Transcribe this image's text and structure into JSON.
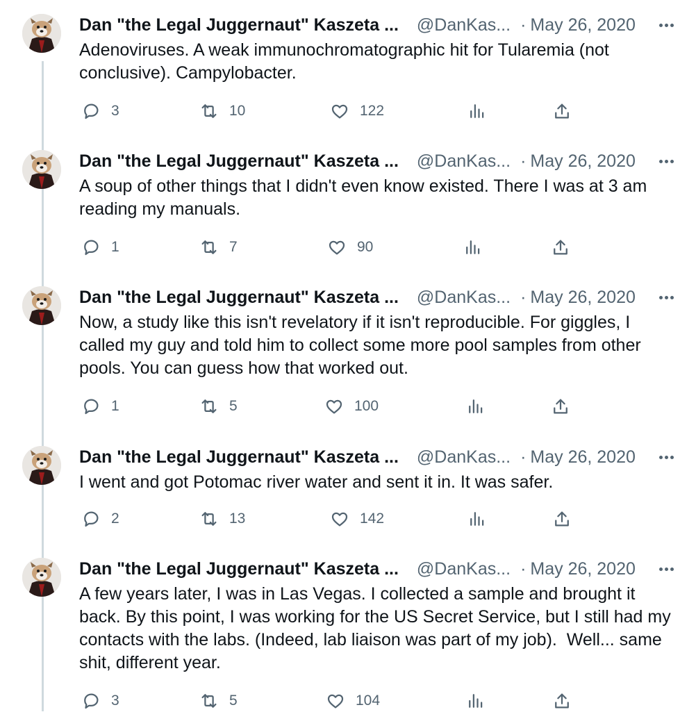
{
  "tweets": [
    {
      "name": "Dan \"the Legal Juggernaut\" Kaszeta ...",
      "handle": "@DanKas...",
      "dot": "·",
      "date": "May 26, 2020",
      "text": "Adenoviruses. A weak immunochromatographic hit for Tularemia (not conclusive). Campylobacter.",
      "replies": "3",
      "retweets": "10",
      "likes": "122"
    },
    {
      "name": "Dan \"the Legal Juggernaut\" Kaszeta ...",
      "handle": "@DanKas...",
      "dot": "·",
      "date": "May 26, 2020",
      "text": "A soup of other things that I didn't even know existed. There I was at 3 am reading my manuals.",
      "replies": "1",
      "retweets": "7",
      "likes": "90"
    },
    {
      "name": "Dan \"the Legal Juggernaut\" Kaszeta ...",
      "handle": "@DanKas...",
      "dot": "·",
      "date": "May 26, 2020",
      "text": "Now, a study like this isn't revelatory if it isn't reproducible. For giggles, I called my guy and told him to collect some more pool samples from other pools. You can guess how that worked out.",
      "replies": "1",
      "retweets": "5",
      "likes": "100"
    },
    {
      "name": "Dan \"the Legal Juggernaut\" Kaszeta ...",
      "handle": "@DanKas...",
      "dot": "·",
      "date": "May 26, 2020",
      "text": "I went and got Potomac river water and sent it in. It was safer.",
      "replies": "2",
      "retweets": "13",
      "likes": "142"
    },
    {
      "name": "Dan \"the Legal Juggernaut\" Kaszeta ...",
      "handle": "@DanKas...",
      "dot": "·",
      "date": "May 26, 2020",
      "text": "A few years later, I was in Las Vegas. I collected a sample and brought it back. By this point, I was working for the US Secret Service, but I still had my contacts with the labs. (Indeed, lab liaison was part of my job).  Well... same shit, different year.",
      "replies": "3",
      "retweets": "5",
      "likes": "104"
    }
  ],
  "icons": {
    "avatar": "cartoon-dog-avatar-icon",
    "reply": "speech-bubble-icon",
    "retweet": "retweet-arrows-icon",
    "like": "heart-icon",
    "views": "bar-chart-icon",
    "share": "share-upload-icon",
    "more": "more-dots-icon"
  },
  "colors": {
    "text": "#0f1419",
    "secondary": "#536471",
    "thread_line": "#cfd9de",
    "background": "#ffffff"
  }
}
